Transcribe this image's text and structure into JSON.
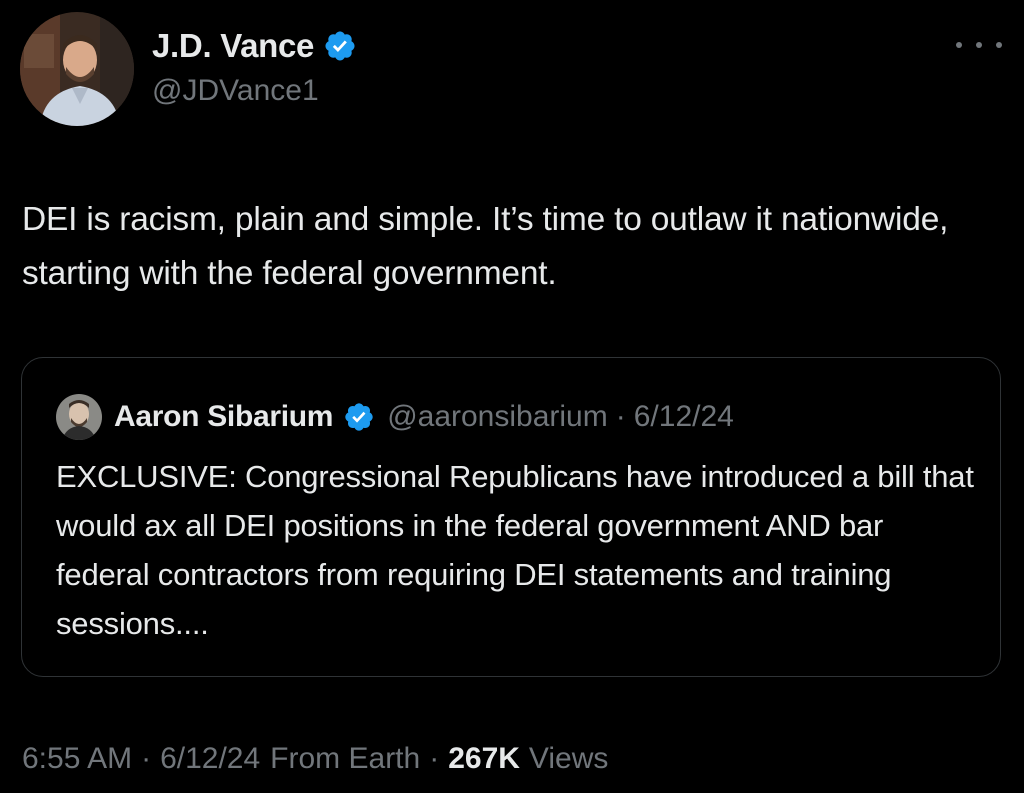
{
  "tweet": {
    "author": {
      "name": "J.D. Vance",
      "handle": "@JDVance1",
      "verified": true
    },
    "more_icon": "more-dots-icon",
    "text": "DEI is racism, plain and simple. It’s time to outlaw it nationwide, starting with the federal government.",
    "quoted": {
      "author_name": "Aaron Sibarium",
      "handle": "@aaronsibarium",
      "separator": "·",
      "date": "6/12/24",
      "verified": true,
      "text": "EXCLUSIVE: Congressional Republicans have introduced a bill that would ax all DEI positions in the federal government AND bar federal contractors from requiring DEI statements and training sessions...."
    },
    "meta": {
      "time": "6:55 AM",
      "separator": "·",
      "date": "6/12/24",
      "source": "From Earth",
      "views_count": "267K",
      "views_label": "Views"
    }
  },
  "colors": {
    "background": "#000000",
    "primary_text": "#e7e9ea",
    "secondary_text": "#71767b",
    "verified_blue": "#1d9bf0",
    "border": "#2f3336"
  }
}
